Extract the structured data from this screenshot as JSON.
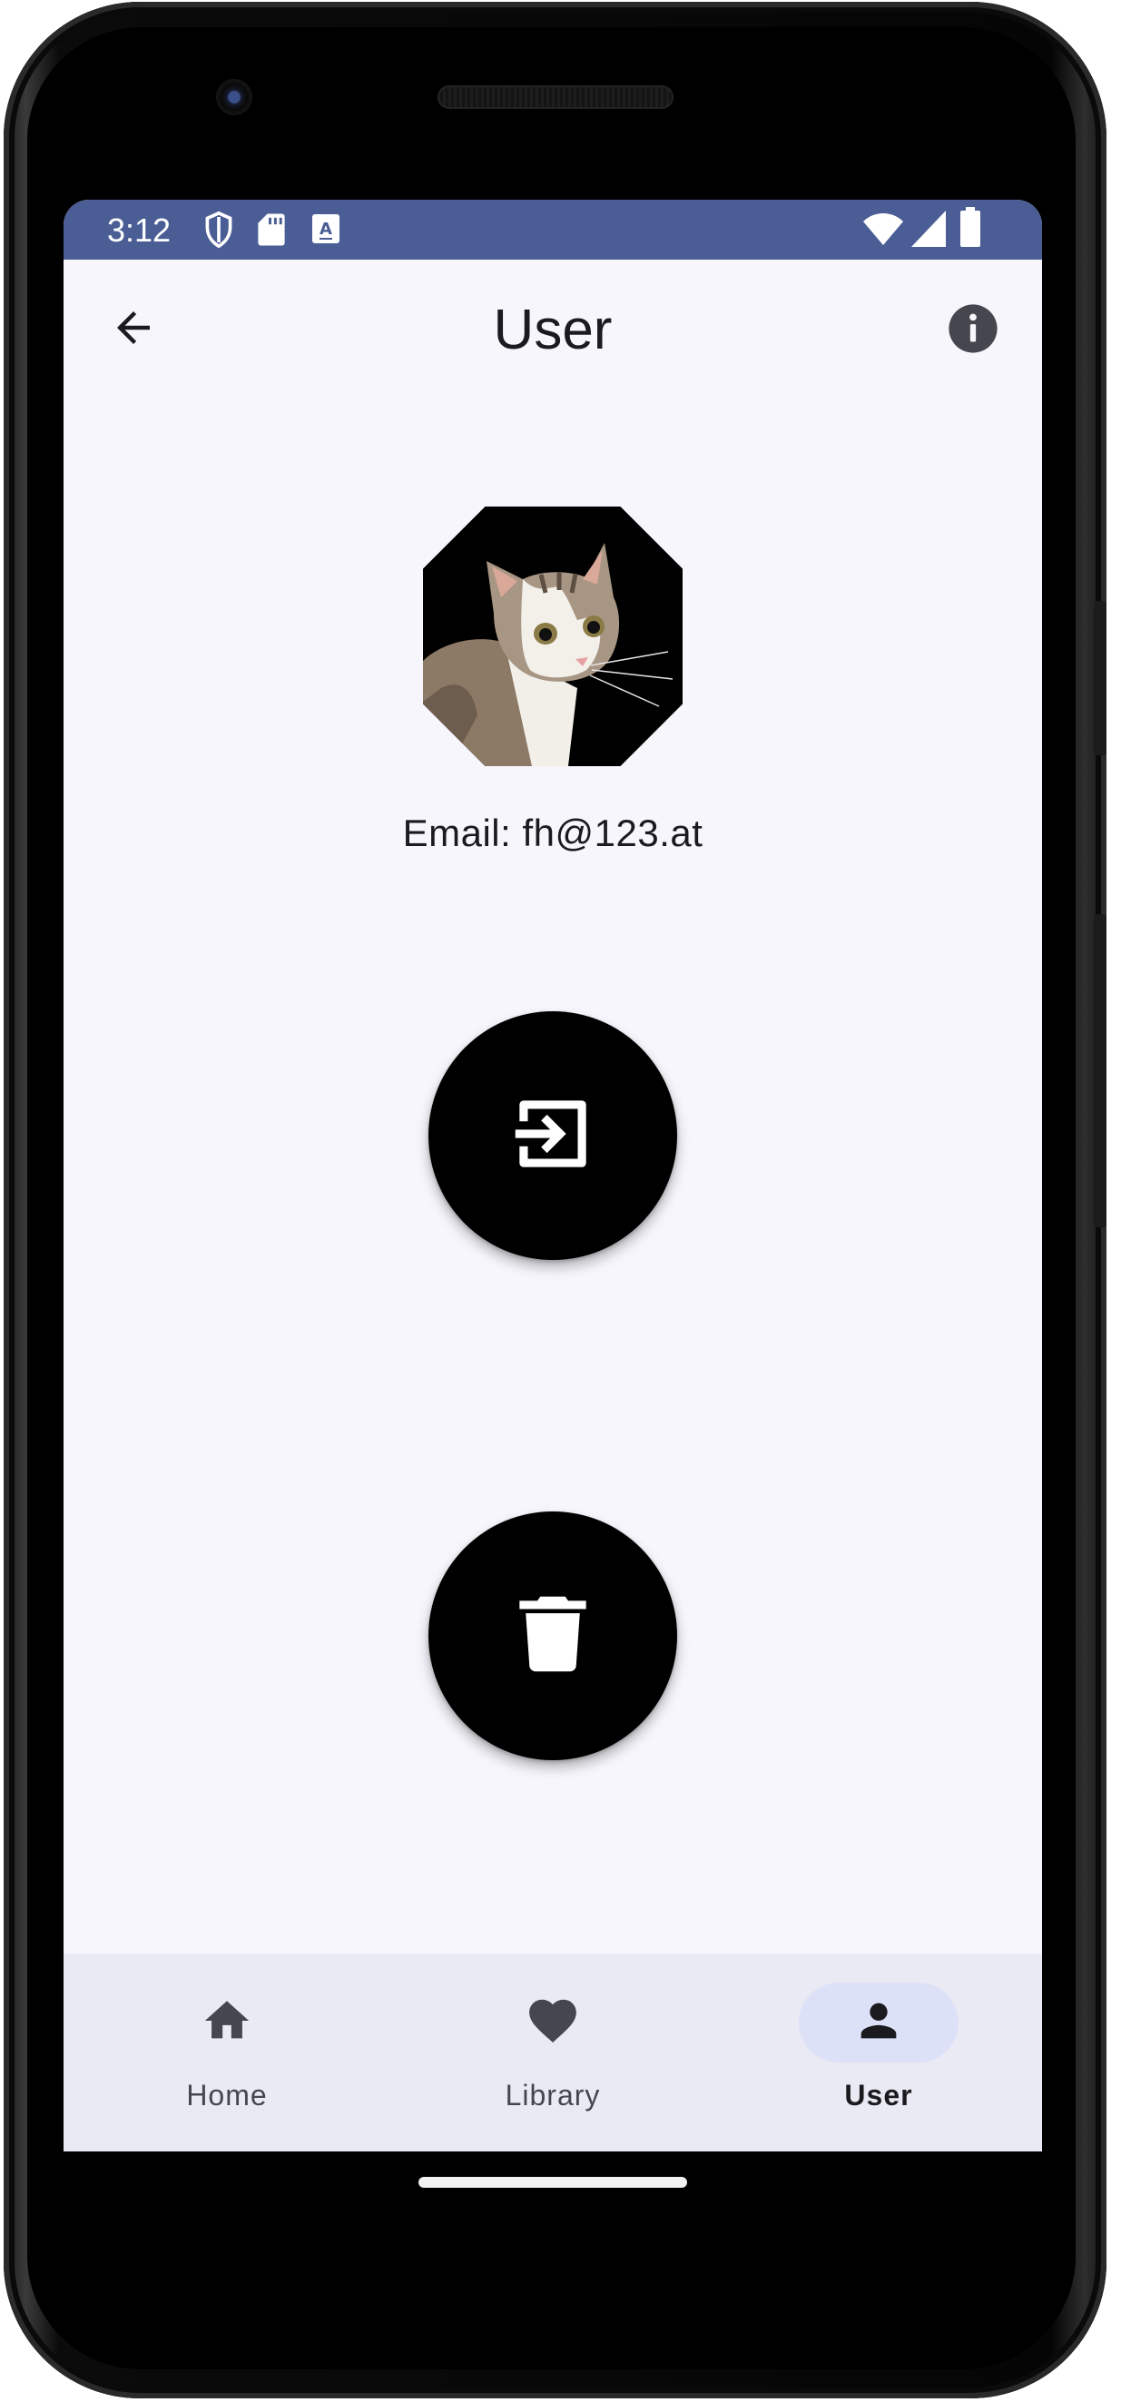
{
  "status_bar": {
    "time": "3:12",
    "left_icons": [
      "shield-icon",
      "sd-card-icon",
      "keyboard-a-icon"
    ],
    "right_icons": [
      "wifi-icon",
      "cell-signal-icon",
      "battery-icon"
    ],
    "color": "#4a5e95"
  },
  "top_bar": {
    "title": "User",
    "back_icon": "arrow-back-icon",
    "info_icon": "info-icon"
  },
  "profile": {
    "avatar": "cat-photo",
    "email_text": "Email: fh@123.at"
  },
  "actions": {
    "logout_icon": "logout-icon",
    "delete_icon": "trash-icon",
    "button_color": "#000000"
  },
  "bottom_nav": {
    "items": [
      {
        "label": "Home",
        "icon": "home-icon",
        "active": false
      },
      {
        "label": "Library",
        "icon": "heart-icon",
        "active": false
      },
      {
        "label": "User",
        "icon": "person-icon",
        "active": true
      }
    ],
    "background": "#eaeaf4",
    "active_pill": "#dde1f8"
  }
}
